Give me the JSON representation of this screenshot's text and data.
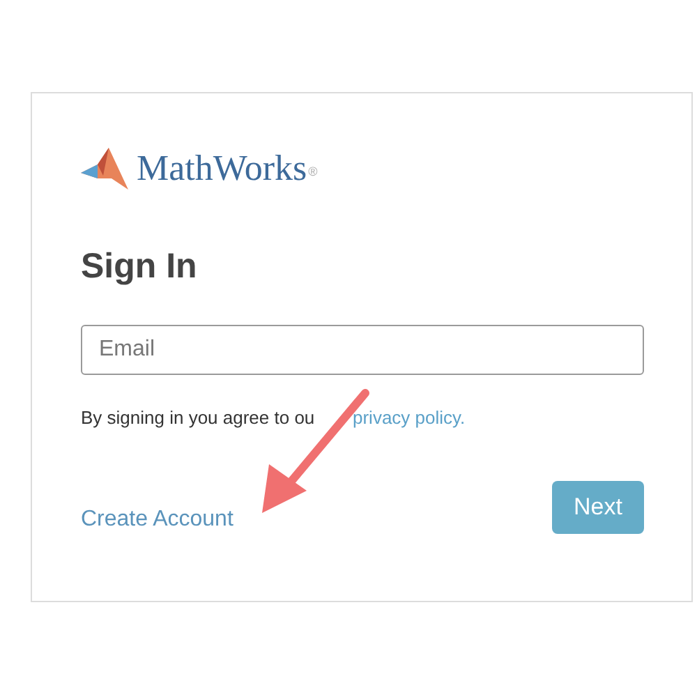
{
  "logo": {
    "wordmark": "MathWorks",
    "registered": "®"
  },
  "heading": "Sign In",
  "email": {
    "placeholder": "Email"
  },
  "agreement": {
    "text": "By signing in you agree to ou",
    "link": "privacy policy."
  },
  "create_account": "Create Account",
  "next_button": "Next",
  "annotation": {
    "kind": "arrow",
    "color": "#f07070"
  }
}
